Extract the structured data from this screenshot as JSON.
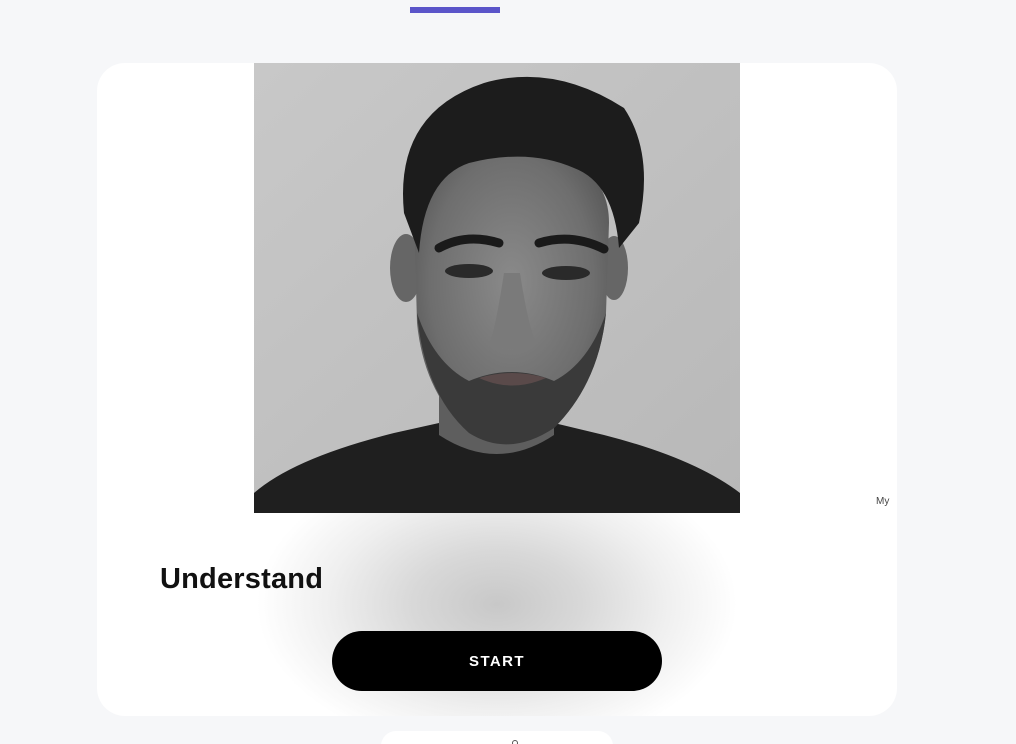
{
  "card": {
    "photo_alt": "Portrait photo",
    "photo_caption": "My",
    "heading": "Understand",
    "start_label": "START"
  },
  "colors": {
    "accent": "#5b55c9",
    "button_bg": "#000000",
    "page_bg": "#f6f7f9"
  }
}
